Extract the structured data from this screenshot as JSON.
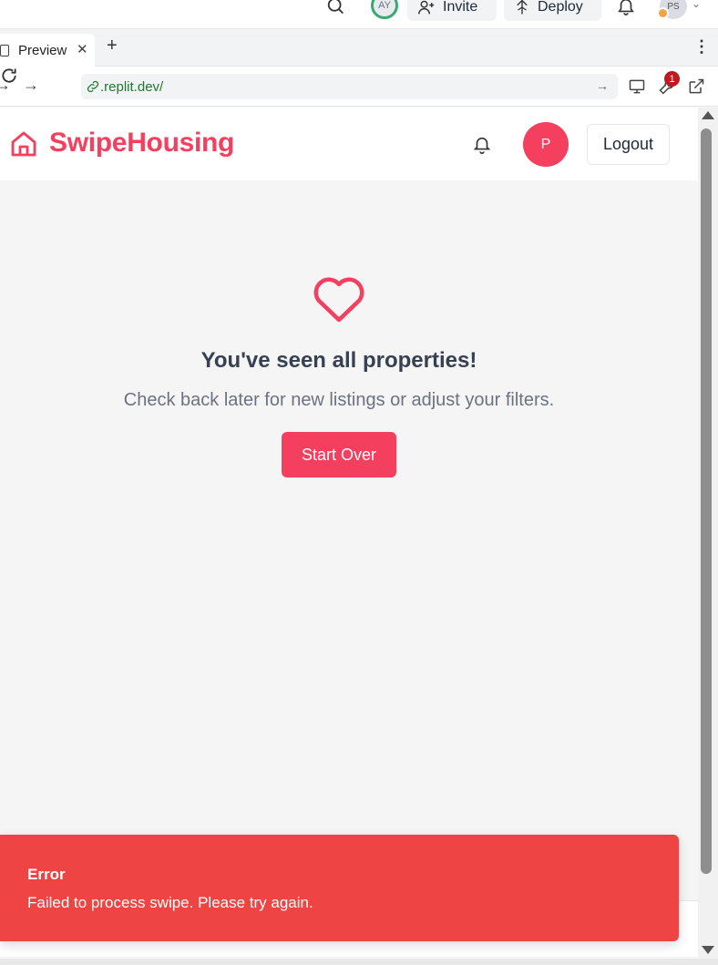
{
  "replit_bar": {
    "user_initials": "AY",
    "invite_label": "Invite",
    "deploy_label": "Deploy",
    "account_initials": "PS"
  },
  "browser": {
    "tab_title": "Preview",
    "url": ".replit.dev/",
    "tools_badge_count": "1"
  },
  "app": {
    "brand_name": "SwipeHousing",
    "user_initial": "P",
    "logout_label": "Logout",
    "brand_color": "#f43f5e"
  },
  "empty_state": {
    "title": "You've seen all properties!",
    "description": "Check back later for new listings or adjust your filters.",
    "button_label": "Start Over"
  },
  "toast": {
    "title": "Error",
    "message": "Failed to process swipe. Please try again.",
    "color": "#ef4444"
  }
}
